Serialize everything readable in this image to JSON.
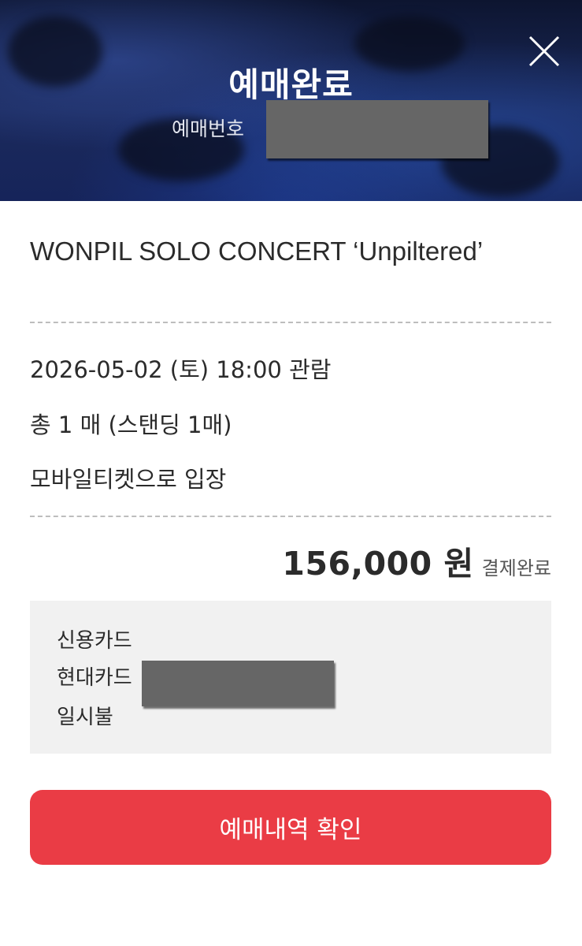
{
  "header": {
    "title": "예매완료",
    "reservation_label": "예매번호",
    "close_icon": "close-icon"
  },
  "concert": {
    "title": "WONPIL SOLO CONCERT ‘Unpiltered’"
  },
  "details": {
    "date_time": "2026-05-02 (토) 18:00 관람",
    "tickets": "총 1 매 (스탠딩 1매)",
    "entry": "모바일티켓으로 입장"
  },
  "price": {
    "amount": "156,000 원",
    "status": "결제완료"
  },
  "payment": {
    "method": "신용카드",
    "card": "현대카드",
    "installment": "일시불"
  },
  "actions": {
    "confirm_label": "예매내역 확인"
  },
  "colors": {
    "accent": "#ea3c45",
    "header_bg": "#16245a",
    "panel_bg": "#f1f1f1"
  }
}
